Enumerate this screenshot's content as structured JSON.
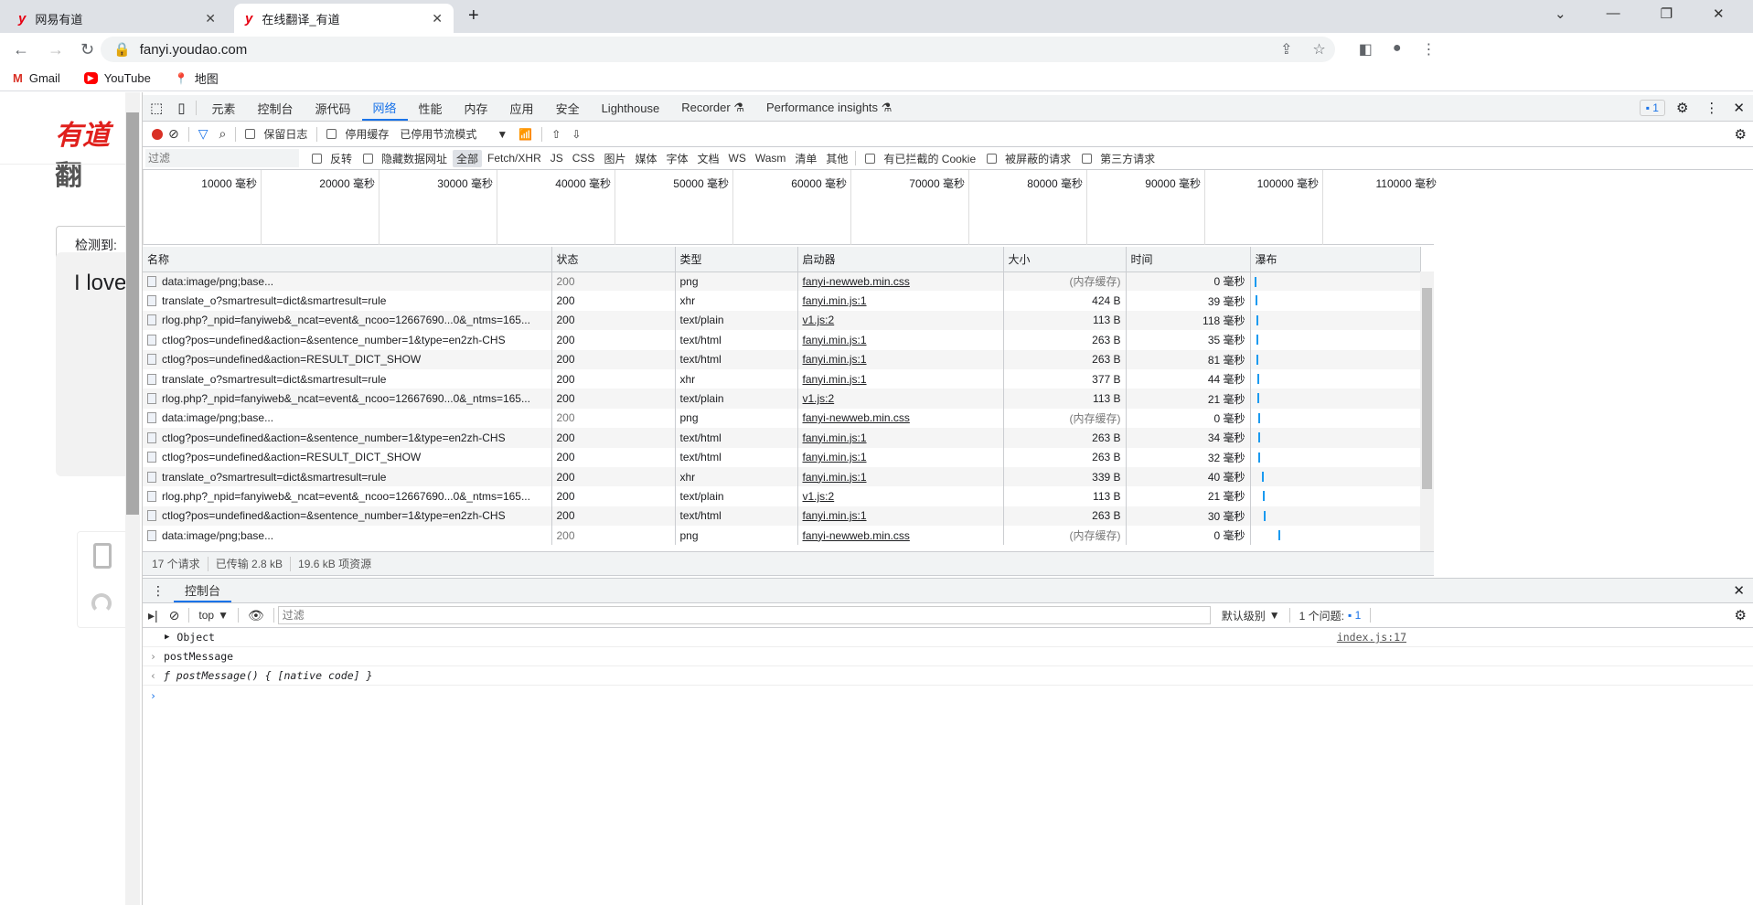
{
  "browser": {
    "tabs": [
      {
        "title": "网易有道",
        "favicon": "y"
      },
      {
        "title": "在线翻译_有道",
        "favicon": "y",
        "active": true
      }
    ],
    "new_tab": "+",
    "url": "fanyi.youdao.com",
    "bookmarks": [
      {
        "label": "Gmail",
        "icon": "M"
      },
      {
        "label": "YouTube",
        "icon": "▶"
      },
      {
        "label": "地图",
        "icon": "📍"
      }
    ]
  },
  "page": {
    "logo": "有道",
    "logo_suffix": "翻",
    "detect_label": "检测到:",
    "input_text": "I love"
  },
  "devtools": {
    "tabs": [
      "元素",
      "控制台",
      "源代码",
      "网络",
      "性能",
      "内存",
      "应用",
      "安全",
      "Lighthouse",
      "Recorder ⚗",
      "Performance insights ⚗"
    ],
    "active_tab": "网络",
    "issues_badge": "1",
    "network_toolbar": {
      "preserve_log": "保留日志",
      "disable_cache": "停用缓存",
      "throttle": "已停用节流模式"
    },
    "filter": {
      "placeholder": "过滤",
      "invert": "反转",
      "hide_data_urls": "隐藏数据网址",
      "types": [
        "全部",
        "Fetch/XHR",
        "JS",
        "CSS",
        "图片",
        "媒体",
        "字体",
        "文档",
        "WS",
        "Wasm",
        "清单",
        "其他"
      ],
      "blocked_cookies": "有已拦截的 Cookie",
      "blocked_requests": "被屏蔽的请求",
      "third_party": "第三方请求"
    },
    "overview_ticks": [
      "10000 毫秒",
      "20000 毫秒",
      "30000 毫秒",
      "40000 毫秒",
      "50000 毫秒",
      "60000 毫秒",
      "70000 毫秒",
      "80000 毫秒",
      "90000 毫秒",
      "100000 毫秒",
      "110000 毫秒"
    ],
    "columns": [
      "名称",
      "状态",
      "类型",
      "启动器",
      "大小",
      "时间",
      "瀑布"
    ],
    "rows": [
      [
        "data:image/png;base...",
        "200",
        "png",
        "fanyi-newweb.min.css",
        "(内存缓存)",
        "0 毫秒"
      ],
      [
        "translate_o?smartresult=dict&smartresult=rule",
        "200",
        "xhr",
        "fanyi.min.js:1",
        "424 B",
        "39 毫秒"
      ],
      [
        "rlog.php?_npid=fanyiweb&_ncat=event&_ncoo=12667690...0&_ntms=165...",
        "200",
        "text/plain",
        "v1.js:2",
        "113 B",
        "118 毫秒"
      ],
      [
        "ctlog?pos=undefined&action=&sentence_number=1&type=en2zh-CHS",
        "200",
        "text/html",
        "fanyi.min.js:1",
        "263 B",
        "35 毫秒"
      ],
      [
        "ctlog?pos=undefined&action=RESULT_DICT_SHOW",
        "200",
        "text/html",
        "fanyi.min.js:1",
        "263 B",
        "81 毫秒"
      ],
      [
        "translate_o?smartresult=dict&smartresult=rule",
        "200",
        "xhr",
        "fanyi.min.js:1",
        "377 B",
        "44 毫秒"
      ],
      [
        "rlog.php?_npid=fanyiweb&_ncat=event&_ncoo=12667690...0&_ntms=165...",
        "200",
        "text/plain",
        "v1.js:2",
        "113 B",
        "21 毫秒"
      ],
      [
        "data:image/png;base...",
        "200",
        "png",
        "fanyi-newweb.min.css",
        "(内存缓存)",
        "0 毫秒"
      ],
      [
        "ctlog?pos=undefined&action=&sentence_number=1&type=en2zh-CHS",
        "200",
        "text/html",
        "fanyi.min.js:1",
        "263 B",
        "34 毫秒"
      ],
      [
        "ctlog?pos=undefined&action=RESULT_DICT_SHOW",
        "200",
        "text/html",
        "fanyi.min.js:1",
        "263 B",
        "32 毫秒"
      ],
      [
        "translate_o?smartresult=dict&smartresult=rule",
        "200",
        "xhr",
        "fanyi.min.js:1",
        "339 B",
        "40 毫秒"
      ],
      [
        "rlog.php?_npid=fanyiweb&_ncat=event&_ncoo=12667690...0&_ntms=165...",
        "200",
        "text/plain",
        "v1.js:2",
        "113 B",
        "21 毫秒"
      ],
      [
        "ctlog?pos=undefined&action=&sentence_number=1&type=en2zh-CHS",
        "200",
        "text/html",
        "fanyi.min.js:1",
        "263 B",
        "30 毫秒"
      ],
      [
        "data:image/png;base...",
        "200",
        "png",
        "fanyi-newweb.min.css",
        "(内存缓存)",
        "0 毫秒"
      ]
    ],
    "summary": {
      "requests": "17 个请求",
      "transferred": "已传输 2.8 kB",
      "resources": "19.6 kB 项资源"
    },
    "drawer": {
      "tab": "控制台",
      "context": "top",
      "filter_placeholder": "过滤",
      "level": "默认级别",
      "issues": "1 个问题:",
      "issues_count": "1",
      "lines": [
        {
          "text": "Object",
          "source": "index.js:17"
        },
        {
          "text": "postMessage"
        },
        {
          "text": "ƒ postMessage() { [native code] }"
        }
      ]
    }
  }
}
